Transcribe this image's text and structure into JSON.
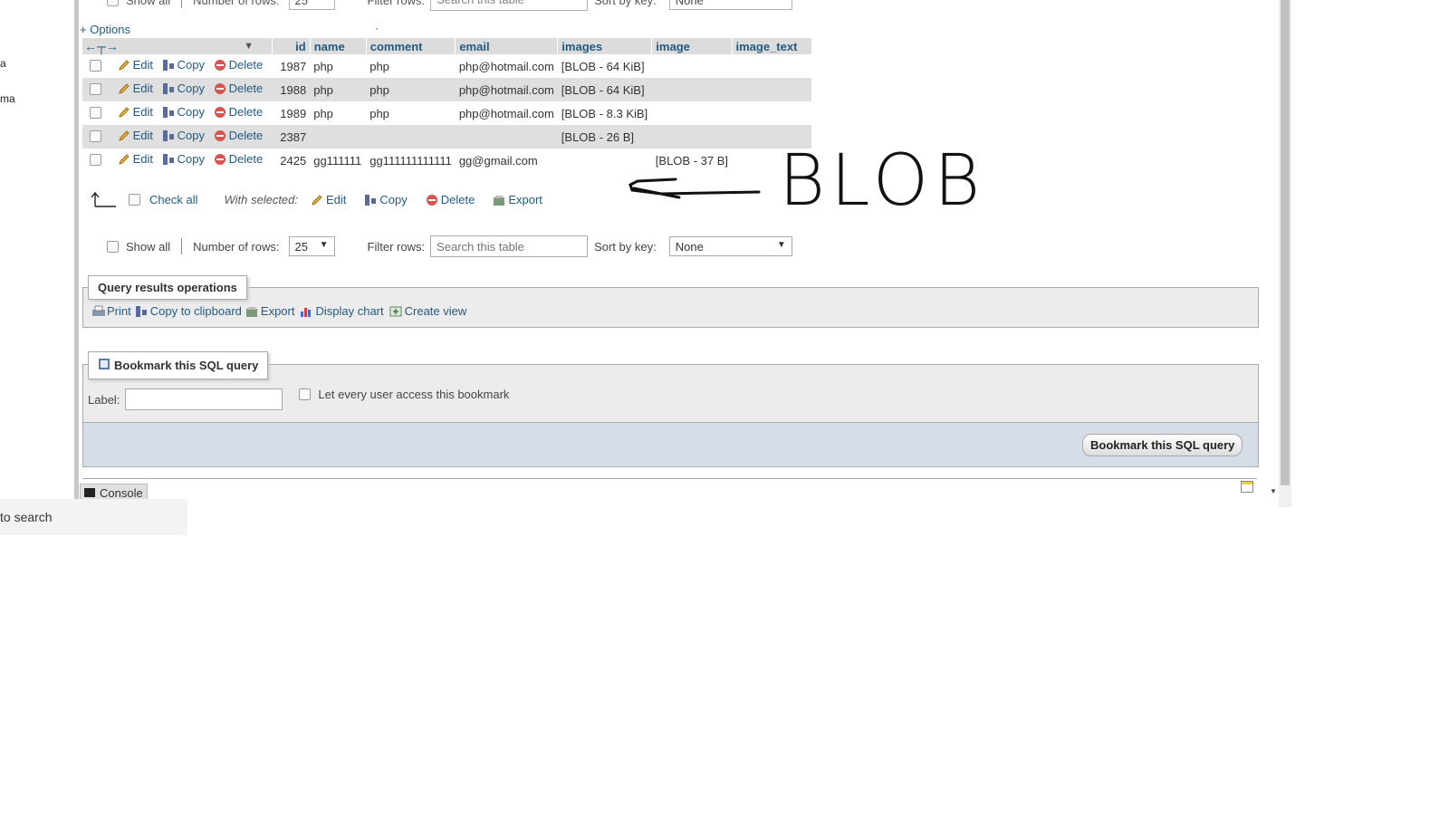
{
  "left_panel": {
    "frag1": "a",
    "frag2": "ma"
  },
  "top_controls": {
    "show_all": "Show all",
    "number_of_rows_label": "Number of rows:",
    "number_of_rows_value": "25",
    "filter_label": "Filter rows:",
    "filter_placeholder": "Search this table",
    "sort_label": "Sort by key:",
    "sort_value": "None"
  },
  "options_link": "+ Options",
  "table": {
    "headers": [
      "id",
      "name",
      "comment",
      "email",
      "images",
      "image",
      "image_text"
    ],
    "actions": {
      "edit": "Edit",
      "copy": "Copy",
      "delete": "Delete"
    },
    "rows": [
      {
        "id": "1987",
        "name": "php",
        "comment": "php",
        "email": "php@hotmail.com",
        "images": "[BLOB - 64 KiB]",
        "image": "",
        "image_text": ""
      },
      {
        "id": "1988",
        "name": "php",
        "comment": "php",
        "email": "php@hotmail.com",
        "images": "[BLOB - 64 KiB]",
        "image": "",
        "image_text": ""
      },
      {
        "id": "1989",
        "name": "php",
        "comment": "php",
        "email": "php@hotmail.com",
        "images": "[BLOB - 8.3 KiB]",
        "image": "",
        "image_text": ""
      },
      {
        "id": "2387",
        "name": "",
        "comment": "",
        "email": "",
        "images": "[BLOB - 26 B]",
        "image": "",
        "image_text": ""
      },
      {
        "id": "2425",
        "name": "gg111111",
        "comment": "gg111111111111",
        "email": "gg@gmail.com",
        "images": "",
        "image": "[BLOB - 37 B]",
        "image_text": ""
      }
    ]
  },
  "bulk": {
    "check_all": "Check all",
    "with_selected": "With selected:",
    "edit": "Edit",
    "copy": "Copy",
    "delete": "Delete",
    "export": "Export"
  },
  "annotation": {
    "text": "BLOB"
  },
  "query_ops": {
    "legend": "Query results operations",
    "print": "Print",
    "copy_clipboard": "Copy to clipboard",
    "export": "Export",
    "display_chart": "Display chart",
    "create_view": "Create view"
  },
  "bookmark": {
    "legend": "Bookmark this SQL query",
    "label": "Label:",
    "let_every_user": "Let every user access this bookmark",
    "submit": "Bookmark this SQL query"
  },
  "console": {
    "label": "Console"
  },
  "taskbar": {
    "search_text": "to search"
  }
}
